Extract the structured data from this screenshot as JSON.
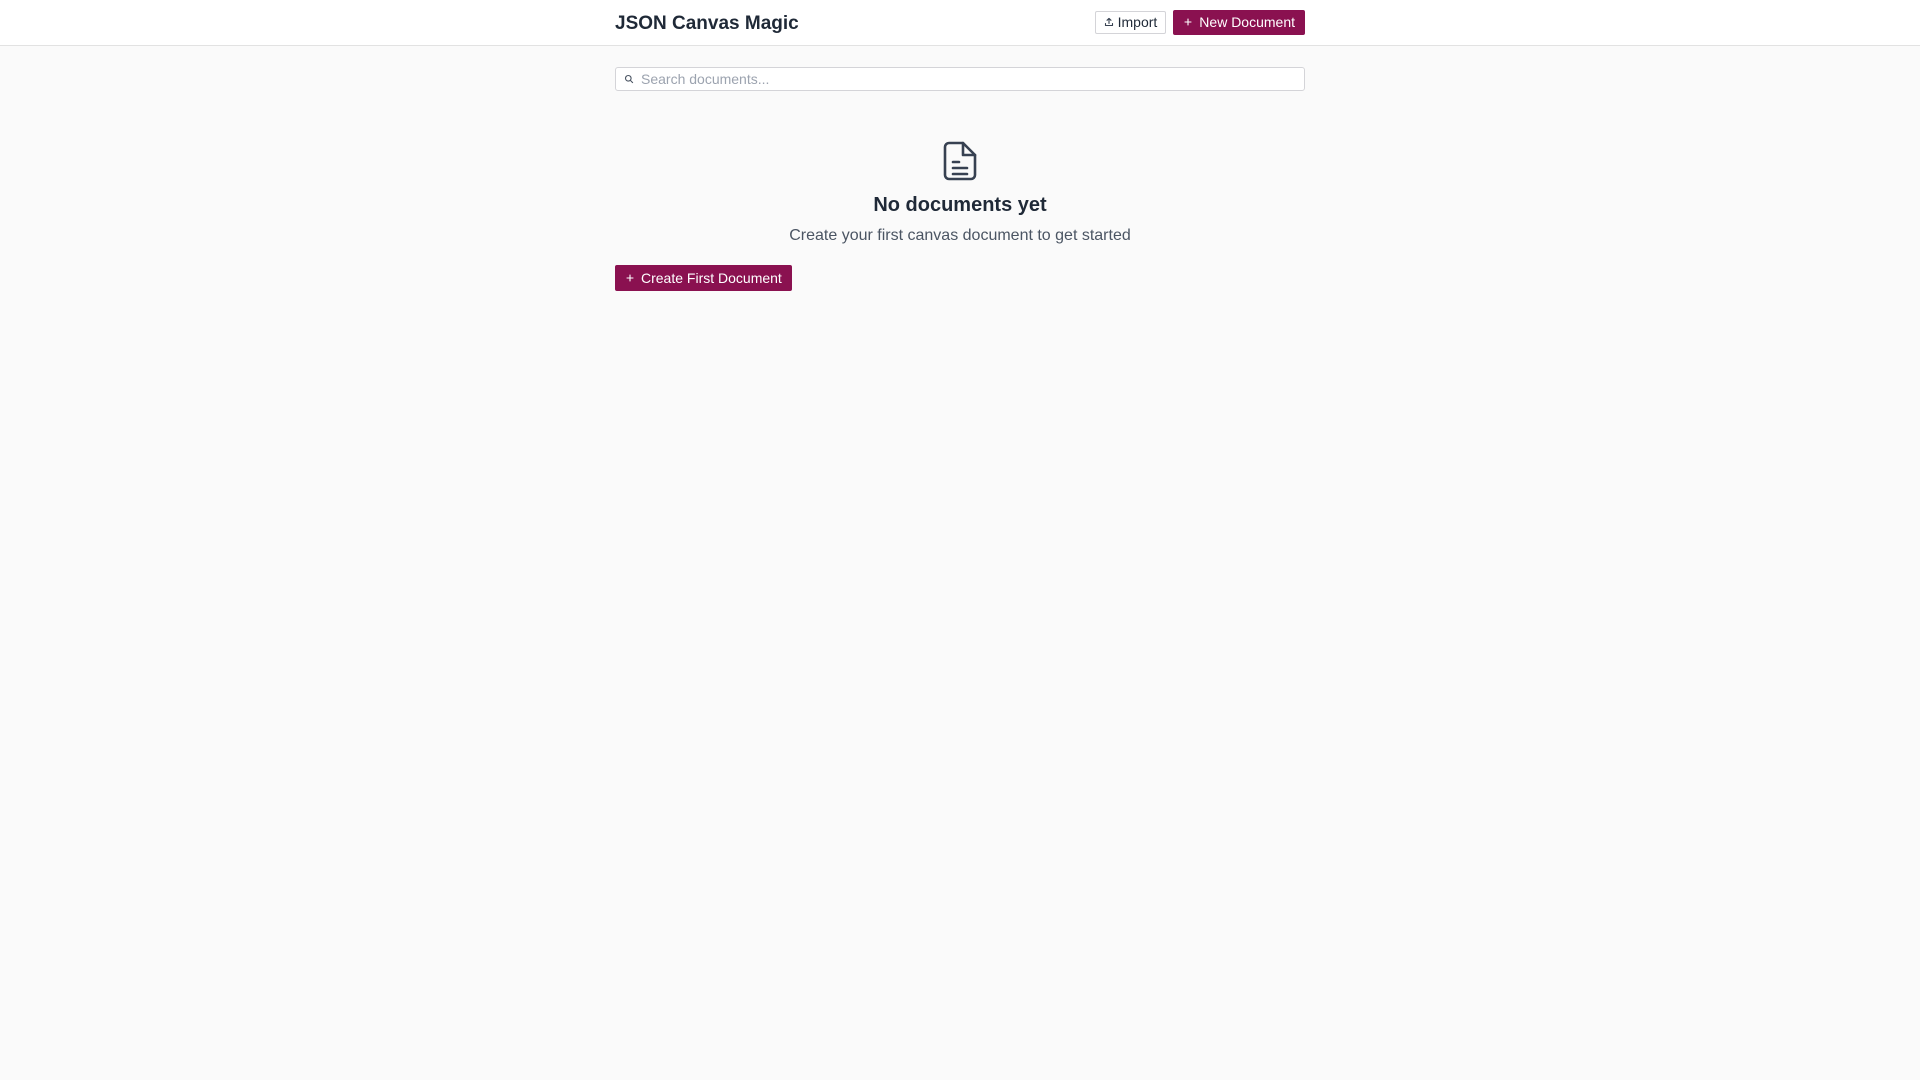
{
  "header": {
    "title": "JSON Canvas Magic",
    "import_label": "Import",
    "new_document_label": "New Document"
  },
  "search": {
    "placeholder": "Search documents...",
    "value": ""
  },
  "empty_state": {
    "icon": "file-text-icon",
    "title": "No documents yet",
    "subtitle": "Create your first canvas document to get started",
    "cta_label": "Create First Document"
  },
  "colors": {
    "accent": "#8a1150",
    "background": "#fafafa",
    "header_bg": "#ffffff",
    "text_primary": "#1f2937",
    "text_secondary": "#4b5563"
  }
}
